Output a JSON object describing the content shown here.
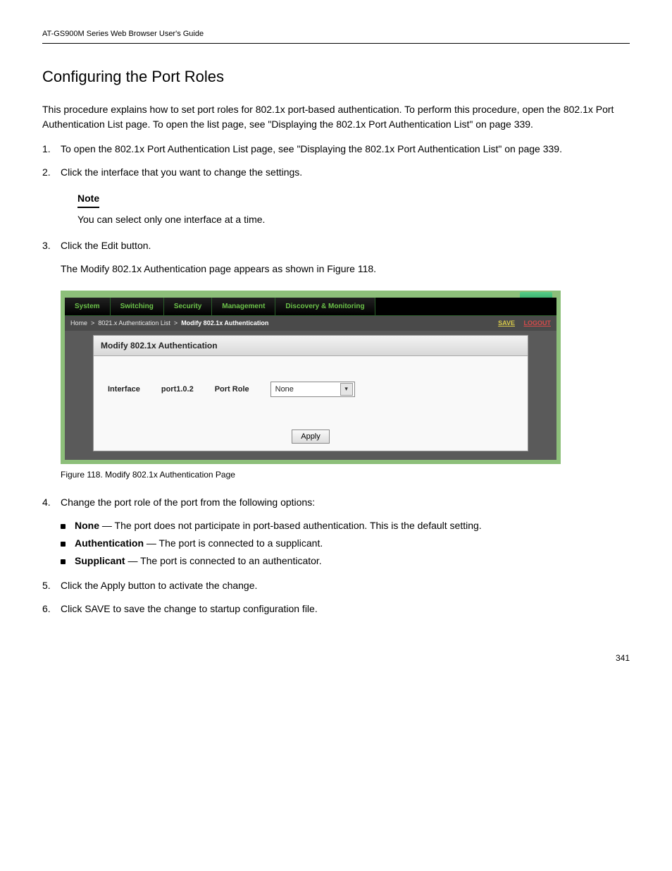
{
  "header": {
    "left": "AT-GS900M Series Web Browser User's Guide",
    "right": ""
  },
  "title": "Configuring the Port Roles",
  "intro": "This procedure explains how to set port roles for 802.1x port-based authentication. To perform this procedure, open the 802.1x Port Authentication List page. To open the list page, see \"Displaying the 802.1x Port Authentication List\" on page 339.",
  "steps": {
    "s1": {
      "num": "1.",
      "text": "To open the 802.1x Port Authentication List page, see \"Displaying the 802.1x Port Authentication List\" on page 339."
    },
    "s2": {
      "num": "2.",
      "text": "Click the interface that you want to change the settings."
    },
    "note": {
      "label": "Note",
      "body": "You can select only one interface at a time."
    },
    "s3": {
      "num": "3.",
      "text": "Click the Edit button."
    },
    "s3_after": "The Modify 802.1x Authentication page appears as shown in Figure 118.",
    "fig_caption": "Figure 118. Modify 802.1x Authentication Page",
    "s4": {
      "num": "4.",
      "text": "Change the port role of the port from the following options:"
    }
  },
  "bullets": {
    "b1_label": "None",
    "b1_text": " — The port does not participate in port-based authentication. This is the default setting.",
    "b2_label": "Authentication",
    "b2_text": " — The port is connected to a supplicant.",
    "b3_label": "Supplicant",
    "b3_text": " — The port is connected to an authenticator."
  },
  "closing": {
    "s5": {
      "num": "5.",
      "text": "Click the Apply button to activate the change."
    },
    "s6": {
      "num": "6.",
      "text": "Click SAVE to save the change to startup configuration file."
    }
  },
  "ui": {
    "tabs": {
      "system": "System",
      "switching": "Switching",
      "security": "Security",
      "management": "Management",
      "discovery": "Discovery & Monitoring"
    },
    "breadcrumb": {
      "home": "Home",
      "sep": ">",
      "l1": "8021.x Authentication List",
      "l2": "Modify 802.1x Authentication"
    },
    "links": {
      "save": "SAVE",
      "logout": "LOGOUT"
    },
    "panel": {
      "title": "Modify 802.1x Authentication",
      "interface_label": "Interface",
      "interface_value": "port1.0.2",
      "role_label": "Port Role",
      "role_value": "None",
      "apply": "Apply"
    }
  },
  "page_number": "341"
}
